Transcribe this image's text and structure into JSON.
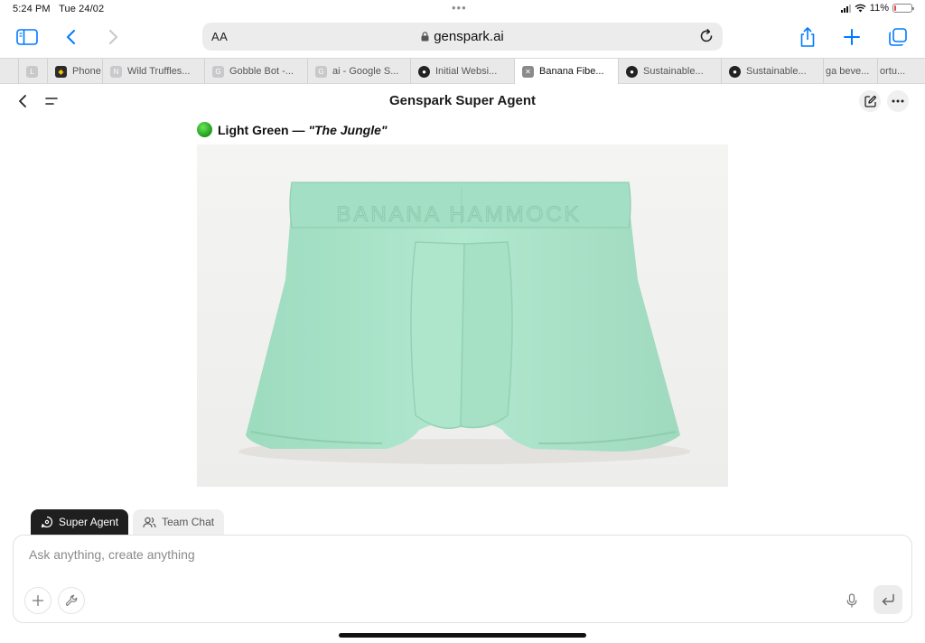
{
  "status_bar": {
    "time": "5:24 PM",
    "date": "Tue 24/02",
    "battery_percent": "11%",
    "battery_level": 0.11
  },
  "browser": {
    "reader_label": "AA",
    "url": "genspark.ai",
    "icons": {
      "sidebar": "sidebar-icon",
      "back": "chevron-left-icon",
      "forward": "chevron-right-icon",
      "share": "share-icon",
      "new_tab": "plus-icon",
      "tabs": "tabs-overview-icon",
      "reload": "reload-icon",
      "lock": "lock-icon"
    },
    "tabs": [
      {
        "label": "",
        "favicon": "L"
      },
      {
        "label": "Phone",
        "favicon": "◆"
      },
      {
        "label": "Wild Truffles...",
        "favicon": "N"
      },
      {
        "label": "Gobble Bot -...",
        "favicon": "G"
      },
      {
        "label": "ai - Google S...",
        "favicon": "G"
      },
      {
        "label": "Initial Websi...",
        "favicon": "●"
      },
      {
        "label": "Banana Fibe...",
        "favicon": "✕",
        "active": true
      },
      {
        "label": "Sustainable...",
        "favicon": "●"
      },
      {
        "label": "Sustainable...",
        "favicon": "●"
      },
      {
        "label": "ga beve...",
        "favicon": ""
      },
      {
        "label": "ortu...",
        "favicon": ""
      }
    ]
  },
  "app": {
    "title": "Genspark Super Agent",
    "content": {
      "color_emoji": "green-circle",
      "color_name": "Light Green — ",
      "color_nickname": "\"The Jungle\"",
      "image": {
        "alt": "Light green boxer brief",
        "waistband_text": "BANANA HAMMOCK",
        "garment_color": "#a9e2c8"
      }
    },
    "modes": [
      {
        "label": "Super Agent",
        "active": true,
        "icon": "agent-icon"
      },
      {
        "label": "Team Chat",
        "active": false,
        "icon": "users-icon"
      }
    ],
    "composer": {
      "placeholder": "Ask anything, create anything"
    }
  }
}
